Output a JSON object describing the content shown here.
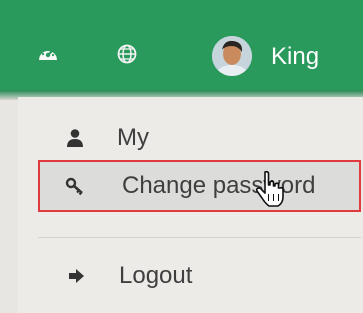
{
  "header": {
    "username": "King",
    "icons": [
      "dashboard-icon",
      "globe-icon"
    ]
  },
  "menu": {
    "items": [
      {
        "label": "My",
        "icon": "user-icon"
      },
      {
        "label": "Change password",
        "icon": "key-icon",
        "highlighted": true
      },
      {
        "label": "Logout",
        "icon": "logout-icon"
      }
    ]
  },
  "colors": {
    "header_bg": "#2a9a5c",
    "menu_bg": "#ecebe8",
    "highlight_border": "#e03a3f",
    "text": "#3f3f3f"
  }
}
